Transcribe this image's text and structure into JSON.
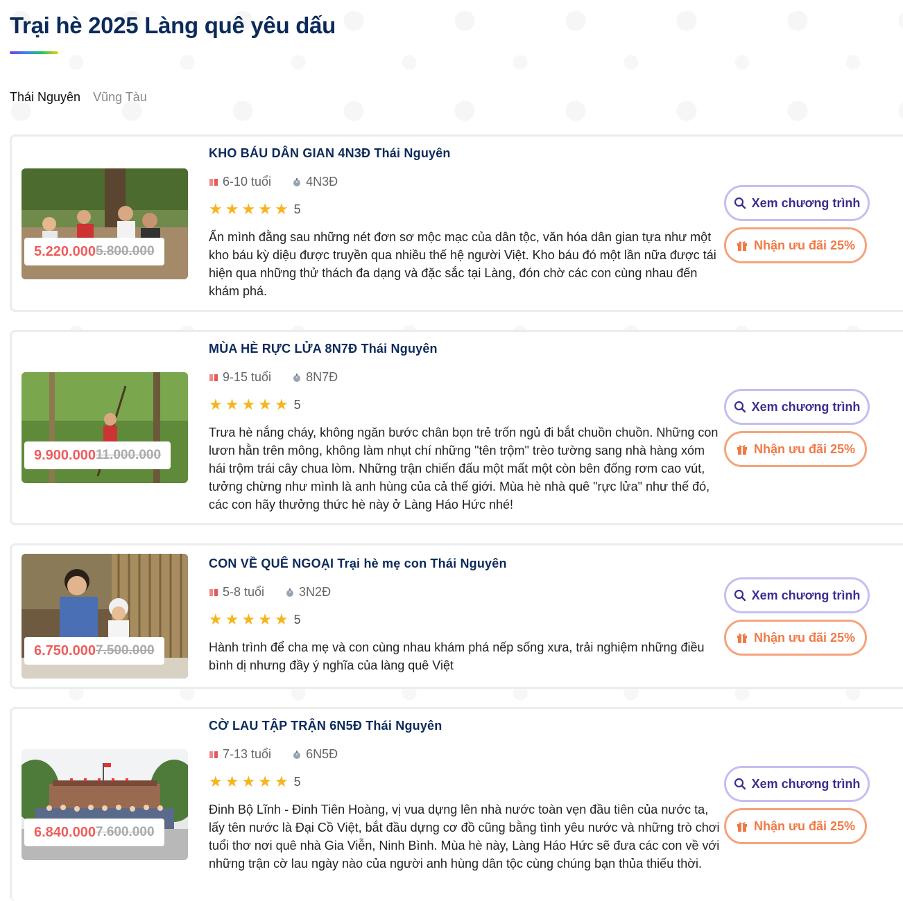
{
  "page": {
    "title": "Trại hè 2025 Làng quê yêu dấu"
  },
  "tabs": [
    {
      "label": "Thái Nguyên",
      "active": true
    },
    {
      "label": "Vũng Tàu",
      "active": false
    }
  ],
  "buttons": {
    "view_label": "Xem chương trình",
    "offer_label": "Nhận ưu đãi 25%"
  },
  "programs": [
    {
      "title": "KHO BÁU DÂN GIAN 4N3Đ Thái Nguyên",
      "age": "6-10 tuổi",
      "duration": "4N3Đ",
      "rating": "5",
      "price_new": "5.220.000",
      "price_old": "5.800.000",
      "description": "Ẩn mình đằng sau những nét đơn sơ mộc mạc của dân tộc, văn hóa dân gian tựa như một kho báu kỳ diệu được truyền qua nhiều thế hệ người Việt. Kho báu đó một lần nữa được tái hiện qua những thử thách đa dạng và đặc sắc tại Làng, đón chờ các con cùng nhau đến khám phá."
    },
    {
      "title": "MÙA HÈ RỰC LỬA 8N7Đ Thái Nguyên",
      "age": "9-15 tuổi",
      "duration": "8N7Đ",
      "rating": "5",
      "price_new": "9.900.000",
      "price_old": "11.000.000",
      "description": "Trưa hè nắng cháy, không ngăn bước chân bọn trẻ trốn ngủ đi bắt chuồn chuồn. Những con lươn hằn trên mông, không làm nhụt chí những \"tên trộm\" trèo tường sang nhà hàng xóm hái trộm trái cây chua lòm. Những trận chiến đấu một mất một còn bên đống rơm cao vút, tưởng chừng như mình là anh hùng của cả thế giới. Mùa hè nhà quê \"rực lửa\" như thế đó, các con hãy thưởng thức hè này ở Làng Háo Hức nhé!"
    },
    {
      "title": "CON VỀ QUÊ NGOẠI Trại hè mẹ con Thái Nguyên",
      "age": "5-8 tuổi",
      "duration": "3N2Đ",
      "rating": "5",
      "price_new": "6.750.000",
      "price_old": "7.500.000",
      "description": "Hành trình để cha mẹ và con cùng nhau khám phá nếp sống xưa, trải nghiệm những điều bình dị nhưng đầy ý nghĩa của làng quê Việt"
    },
    {
      "title": "CỜ LAU TẬP TRẬN 6N5Đ Thái Nguyên",
      "age": "7-13 tuổi",
      "duration": "6N5Đ",
      "rating": "5",
      "price_new": "6.840.000",
      "price_old": "7.600.000",
      "description": "Đinh Bộ Lĩnh - Đinh Tiên Hoàng, vị vua dựng lên nhà nước toàn vẹn đầu tiên của nước ta, lấy tên nước là Đại Cồ Việt, bắt đầu dựng cơ đồ cũng bằng tình yêu nước và những trò chơi tuổi thơ nơi quê nhà Gia Viễn, Ninh Bình. Mùa hè này, Làng Háo Hức sẽ đưa các con về với những trận cờ lau ngày nào của người anh hùng dân tộc cùng chúng bạn thủa thiếu thời."
    }
  ],
  "colors": {
    "title": "#0b2a5a",
    "price_new": "#ef5d5d",
    "star": "#f5b51e",
    "view_border": "#c7bdf2",
    "offer_border": "#f6a27c",
    "offer_text": "#f07a46"
  },
  "icons": {
    "age": "book-icon",
    "duration": "stopwatch-icon",
    "view": "search-icon",
    "offer": "gift-icon",
    "rating": "star-icon"
  }
}
